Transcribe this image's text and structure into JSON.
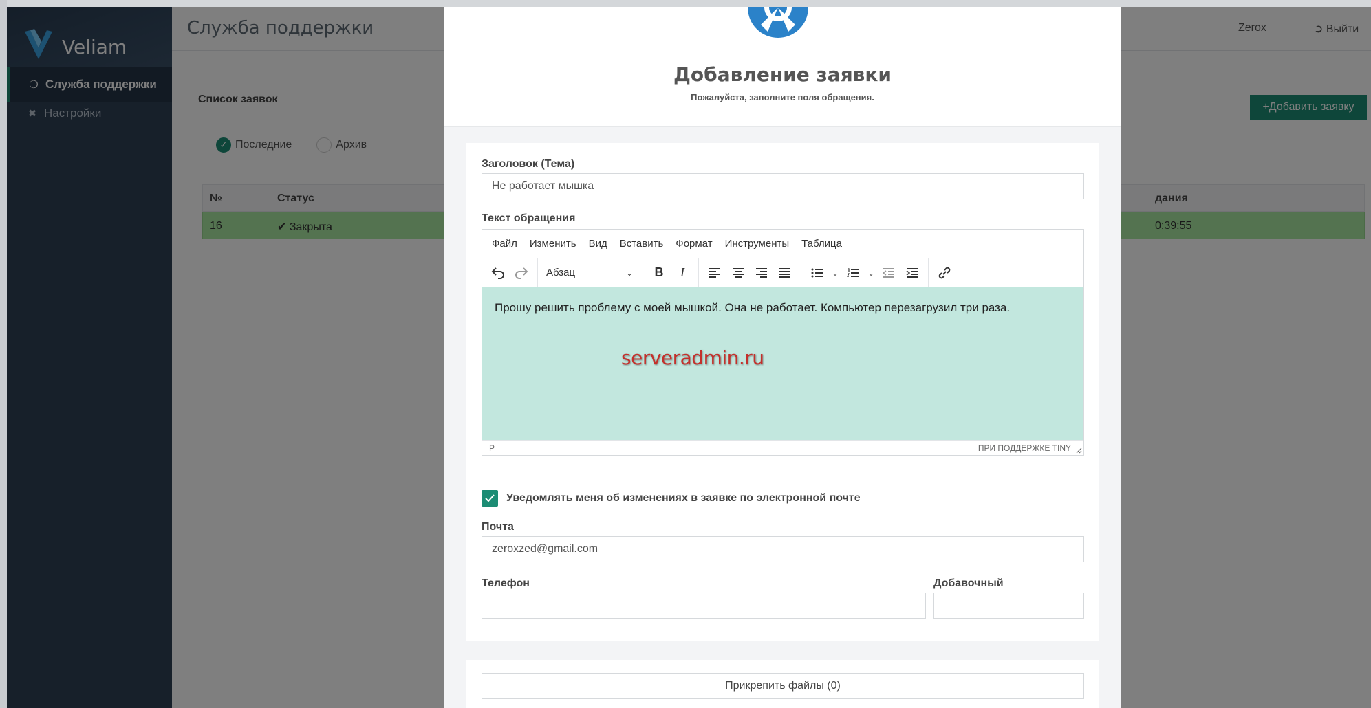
{
  "app": {
    "brand": "Veliam",
    "sidebar": {
      "items": [
        {
          "label": "Служба поддержки",
          "icon": "lifebuoy-icon"
        },
        {
          "label": "Настройки",
          "icon": "tools-icon"
        }
      ]
    },
    "page_title": "Служба поддержки",
    "user_name": "Zerox",
    "logout_label": "Выйти",
    "panel_title": "Список заявок",
    "add_button": "Добавить заявку",
    "filters": {
      "recent": "Последние",
      "archive": "Архив"
    },
    "table": {
      "headers": {
        "num": "№",
        "status": "Статус",
        "date_fragment": "дания"
      },
      "row": {
        "num": "16",
        "status": "Закрыта",
        "time_fragment": "0:39:55"
      }
    },
    "accent_color": "#1c8c74"
  },
  "modal": {
    "title": "Добавление заявки",
    "subtitle": "Пожалуйста, заполните поля обращения.",
    "subject_label": "Заголовок (Тема)",
    "subject_value": "Не работает мышка",
    "message_label": "Текст обращения",
    "editor": {
      "menu": [
        "Файл",
        "Изменить",
        "Вид",
        "Вставить",
        "Формат",
        "Инструменты",
        "Таблица"
      ],
      "format_select": "Абзац",
      "content": "Прошу решить проблему с моей мышкой. Она не работает. Компьютер перезагрузил три раза.",
      "watermark": "serveradmin.ru",
      "status_path": "P",
      "status_brand": "ПРИ ПОДДЕРЖКЕ TINY"
    },
    "notify_label": "Уведомлять меня об изменениях в заявке по электронной почте",
    "email_label": "Почта",
    "email_value": "zeroxzed@gmail.com",
    "phone_label": "Телефон",
    "phone_value": "",
    "ext_label": "Добавочный",
    "ext_value": "",
    "attach_button": "Прикрепить файлы (0)"
  }
}
